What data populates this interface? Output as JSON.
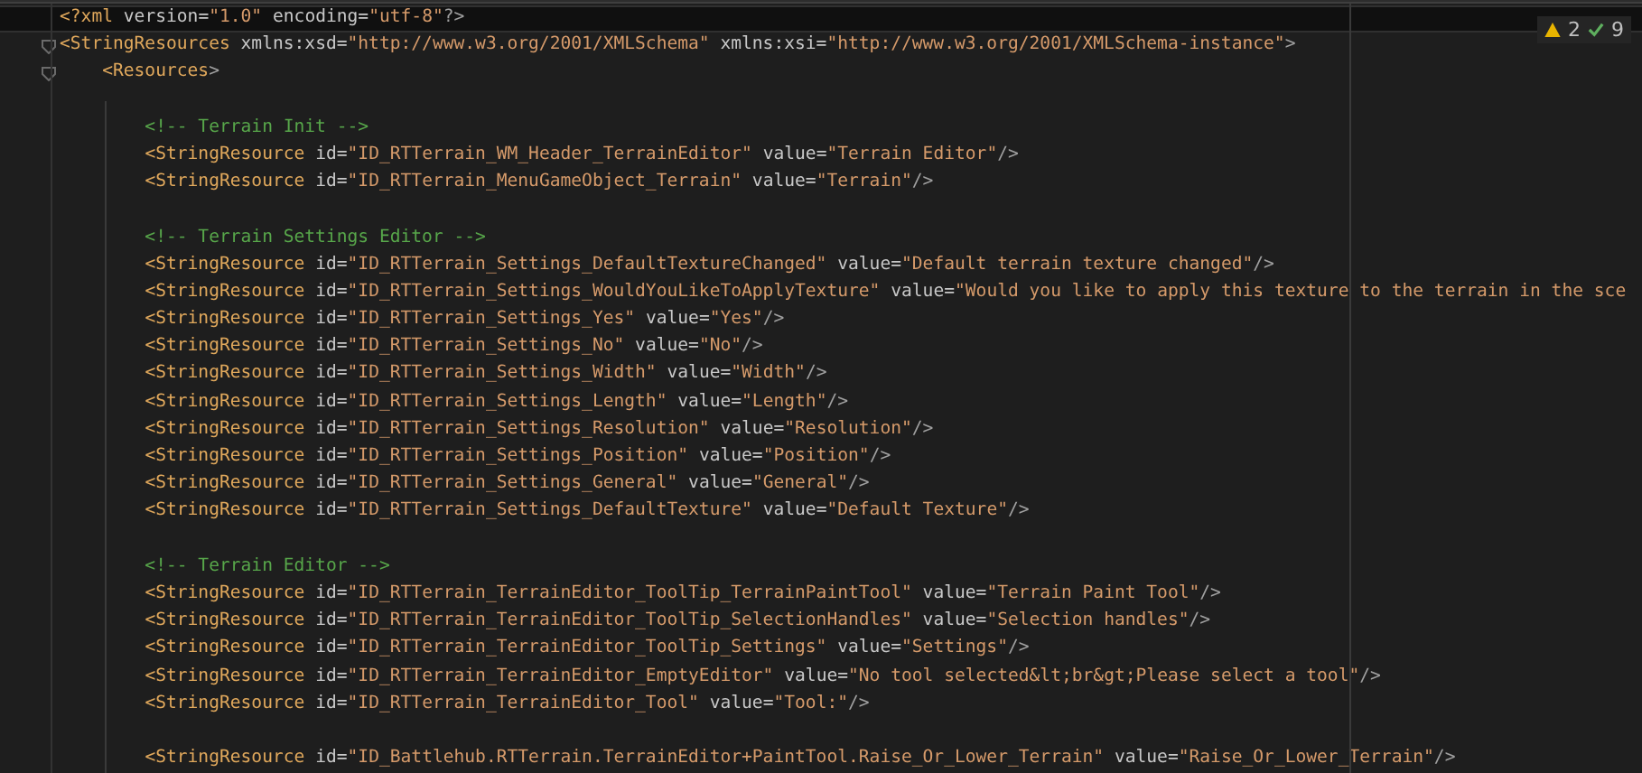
{
  "status": {
    "warnings": "2",
    "checks": "9"
  },
  "lines": [
    {
      "kind": "code",
      "text": "<?xml version=\"1.0\" encoding=\"utf-8\"?>",
      "current": true,
      "fold": false
    },
    {
      "kind": "code",
      "text": "<StringResources xmlns:xsd=\"http://www.w3.org/2001/XMLSchema\" xmlns:xsi=\"http://www.w3.org/2001/XMLSchema-instance\">",
      "current": false,
      "fold": true
    },
    {
      "kind": "code",
      "text": "    <Resources>",
      "current": false,
      "fold": true
    },
    {
      "kind": "blank",
      "current": false,
      "fold": false
    },
    {
      "kind": "comment",
      "text": "        <!-- Terrain Init -->",
      "current": false,
      "fold": false
    },
    {
      "kind": "code",
      "text": "        <StringResource id=\"ID_RTTerrain_WM_Header_TerrainEditor\" value=\"Terrain Editor\"/>",
      "current": false,
      "fold": false
    },
    {
      "kind": "code",
      "text": "        <StringResource id=\"ID_RTTerrain_MenuGameObject_Terrain\" value=\"Terrain\"/>",
      "current": false,
      "fold": false
    },
    {
      "kind": "blank",
      "current": false,
      "fold": false
    },
    {
      "kind": "comment",
      "text": "        <!-- Terrain Settings Editor -->",
      "current": false,
      "fold": false
    },
    {
      "kind": "code",
      "text": "        <StringResource id=\"ID_RTTerrain_Settings_DefaultTextureChanged\" value=\"Default terrain texture changed\"/>",
      "current": false,
      "fold": false
    },
    {
      "kind": "code",
      "text": "        <StringResource id=\"ID_RTTerrain_Settings_WouldYouLikeToApplyTexture\" value=\"Would you like to apply this texture to the terrain in the sce",
      "current": false,
      "fold": false
    },
    {
      "kind": "code",
      "text": "        <StringResource id=\"ID_RTTerrain_Settings_Yes\" value=\"Yes\"/>",
      "current": false,
      "fold": false
    },
    {
      "kind": "code",
      "text": "        <StringResource id=\"ID_RTTerrain_Settings_No\" value=\"No\"/>",
      "current": false,
      "fold": false
    },
    {
      "kind": "code",
      "text": "        <StringResource id=\"ID_RTTerrain_Settings_Width\" value=\"Width\"/>",
      "current": false,
      "fold": false
    },
    {
      "kind": "code",
      "text": "        <StringResource id=\"ID_RTTerrain_Settings_Length\" value=\"Length\"/>",
      "current": false,
      "fold": false
    },
    {
      "kind": "code",
      "text": "        <StringResource id=\"ID_RTTerrain_Settings_Resolution\" value=\"Resolution\"/>",
      "current": false,
      "fold": false
    },
    {
      "kind": "code",
      "text": "        <StringResource id=\"ID_RTTerrain_Settings_Position\" value=\"Position\"/>",
      "current": false,
      "fold": false
    },
    {
      "kind": "code",
      "text": "        <StringResource id=\"ID_RTTerrain_Settings_General\" value=\"General\"/>",
      "current": false,
      "fold": false
    },
    {
      "kind": "code",
      "text": "        <StringResource id=\"ID_RTTerrain_Settings_DefaultTexture\" value=\"Default Texture\"/>",
      "current": false,
      "fold": false
    },
    {
      "kind": "blank",
      "current": false,
      "fold": false
    },
    {
      "kind": "comment",
      "text": "        <!-- Terrain Editor -->",
      "current": false,
      "fold": false
    },
    {
      "kind": "code",
      "text": "        <StringResource id=\"ID_RTTerrain_TerrainEditor_ToolTip_TerrainPaintTool\" value=\"Terrain Paint Tool\"/>",
      "current": false,
      "fold": false
    },
    {
      "kind": "code",
      "text": "        <StringResource id=\"ID_RTTerrain_TerrainEditor_ToolTip_SelectionHandles\" value=\"Selection handles\"/>",
      "current": false,
      "fold": false
    },
    {
      "kind": "code",
      "text": "        <StringResource id=\"ID_RTTerrain_TerrainEditor_ToolTip_Settings\" value=\"Settings\"/>",
      "current": false,
      "fold": false
    },
    {
      "kind": "code",
      "text": "        <StringResource id=\"ID_RTTerrain_TerrainEditor_EmptyEditor\" value=\"No tool selected&lt;br&gt;Please select a tool\"/>",
      "current": false,
      "fold": false
    },
    {
      "kind": "code",
      "text": "        <StringResource id=\"ID_RTTerrain_TerrainEditor_Tool\" value=\"Tool:\"/>",
      "current": false,
      "fold": false
    },
    {
      "kind": "blank",
      "current": false,
      "fold": false
    },
    {
      "kind": "code",
      "text": "        <StringResource id=\"ID_Battlehub.RTTerrain.TerrainEditor+PaintTool.Raise_Or_Lower_Terrain\" value=\"Raise_Or_Lower_Terrain\"/>",
      "current": false,
      "fold": false
    }
  ]
}
